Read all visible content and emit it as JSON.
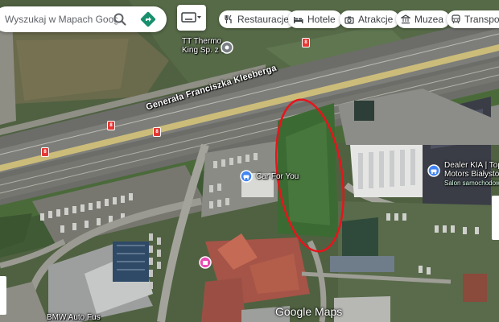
{
  "search": {
    "placeholder": "Wyszukaj w Mapach Google"
  },
  "chips": [
    {
      "label": "Restauracje",
      "icon": "fork-knife-icon"
    },
    {
      "label": "Hotele",
      "icon": "bed-icon"
    },
    {
      "label": "Atrakcje",
      "icon": "camera-icon"
    },
    {
      "label": "Muzea",
      "icon": "museum-icon"
    },
    {
      "label": "Transport",
      "icon": "transit-icon"
    }
  ],
  "street_label": "Generała Franciszka Kleeberga",
  "route_badge": "8",
  "places": {
    "tt_thermo_line1": "TT Thermo",
    "tt_thermo_line2": "King Sp. z oo",
    "car_for_you": "Car For You",
    "kia_line1": "Dealer KIA | Top",
    "kia_line2": "Motors Białystok",
    "kia_line3": "Salon samochodowy",
    "bmw": "BMW Auto Fus"
  },
  "logo": "Google Maps",
  "colors": {
    "accent_green": "#1a8f6e",
    "highlight_circle": "#e8141c",
    "place_pin": "#4285f4",
    "shop_pin": "#e94cb5",
    "road_yellow": "#d9c77a"
  }
}
